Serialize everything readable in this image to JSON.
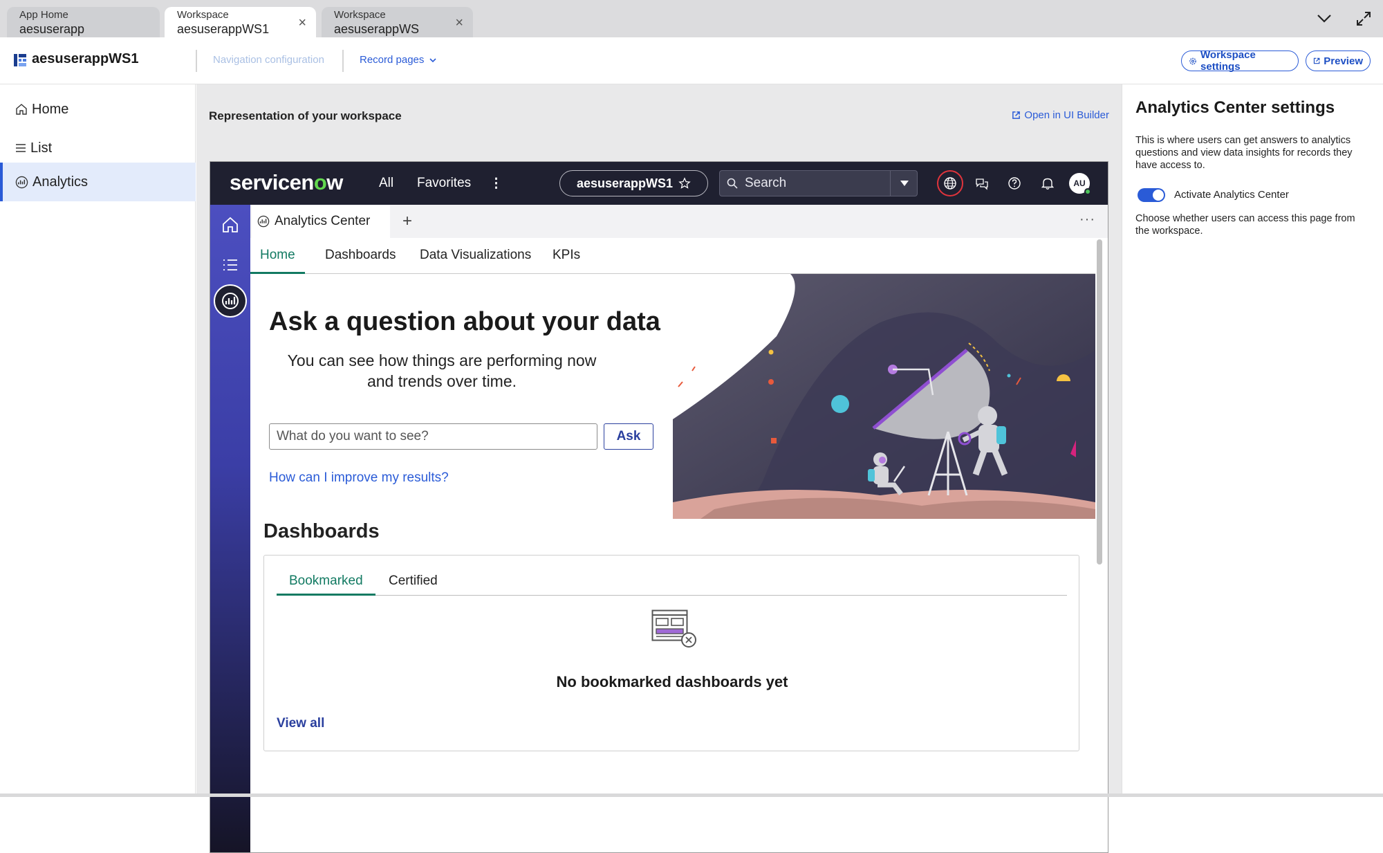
{
  "tabstrip": {
    "tabs": [
      {
        "caption": "App Home",
        "name": "aesuserapp"
      },
      {
        "caption": "Workspace",
        "name": "aesuserappWS1"
      },
      {
        "caption": "Workspace",
        "name": "aesuserappWS"
      }
    ],
    "close_glyph": "×",
    "icons": [
      "chevron-down-icon",
      "expand-icon"
    ]
  },
  "header": {
    "app_title": "aesuserappWS1",
    "nav_config": "Navigation configuration",
    "record_pages": "Record pages",
    "workspace_settings": "Workspace settings",
    "preview": "Preview"
  },
  "sidebar": {
    "items": [
      {
        "label": "Home",
        "icon": "home-icon"
      },
      {
        "label": "List",
        "icon": "list-icon"
      },
      {
        "label": "Analytics",
        "icon": "analytics-icon",
        "active": true
      }
    ]
  },
  "main": {
    "title": "Representation of your workspace",
    "open_ui_builder": "Open in UI Builder"
  },
  "servicenow": {
    "logo_prefix": "servicen",
    "logo_o": "o",
    "logo_suffix": "w",
    "all": "All",
    "favorites": "Favorites",
    "more_glyph": "⋮",
    "workspace_pill": "aesuserappWS1",
    "search_placeholder": "Search",
    "avatar_initials": "AU",
    "tab_label": "Analytics Center",
    "plus_glyph": "+",
    "tab_more_glyph": "···",
    "subtabs": [
      "Home",
      "Dashboards",
      "Data Visualizations",
      "KPIs"
    ],
    "hero_title": "Ask a question about your data",
    "hero_subtitle": "You can see how things are performing now and trends over time.",
    "ask_placeholder": "What do you want to see?",
    "ask_button": "Ask",
    "improve_link": "How can I improve my results?",
    "dashboards_heading": "Dashboards",
    "dash_tabs": [
      "Bookmarked",
      "Certified"
    ],
    "empty_text": "No bookmarked dashboards yet",
    "view_all": "View all"
  },
  "settings_panel": {
    "title": "Analytics Center settings",
    "description": "This is where users can get answers to analytics questions and view data insights for records they have access to.",
    "toggle_label": "Activate Analytics Center",
    "toggle_on": true,
    "toggle_help": "Choose whether users can access this page from the workspace."
  },
  "colors": {
    "accent": "#2a5bd7",
    "active_tab": "#127a62",
    "header_dark": "#1f2030",
    "rail_top": "#4c4fc0"
  }
}
